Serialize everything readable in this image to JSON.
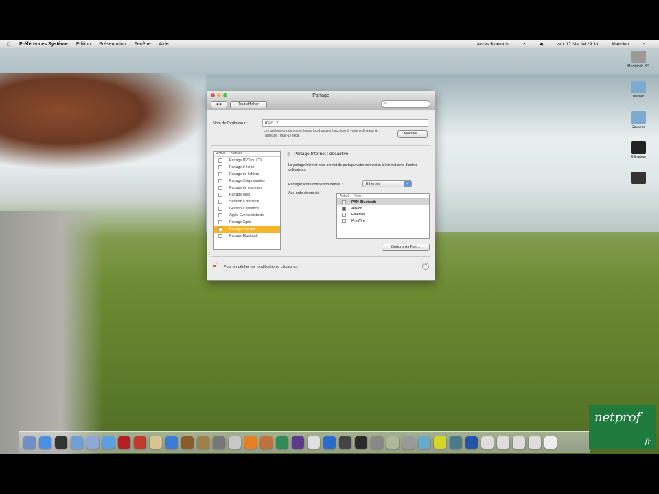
{
  "menubar": {
    "app": "Préférences Système",
    "items": [
      "Édition",
      "Présentation",
      "Fenêtre",
      "Aide"
    ],
    "status": "Accès Bluetooth",
    "clock": "ven. 17 Mai  14:29:33",
    "user": "Matthieu"
  },
  "desktop_icons": [
    {
      "label": "Macintosh HD",
      "color": "#9a9a9a"
    },
    {
      "label": "dossier",
      "color": "#7eaad2"
    },
    {
      "label": "Captures",
      "color": "#7eaad2"
    },
    {
      "label": "Utilisateur",
      "color": "#222222"
    },
    {
      "label": "",
      "color": "#333333"
    }
  ],
  "window": {
    "title": "Partage",
    "show_all": "Tout afficher",
    "search_placeholder": "",
    "computer_name_label": "Nom de l'ordinateur :",
    "computer_name": "mac 17",
    "address_text": "Les ordinateurs de votre réseau local peuvent accéder à votre ordinateur à l'adresse : mac-17.local",
    "edit_button": "Modifier…",
    "services_header": {
      "on": "Activé",
      "service": "Service"
    },
    "services": [
      {
        "label": "Partage DVD ou CD",
        "on": false
      },
      {
        "label": "Partage d'écran",
        "on": false
      },
      {
        "label": "Partage de fichiers",
        "on": false
      },
      {
        "label": "Partage d'imprimantes",
        "on": false
      },
      {
        "label": "Partage de scanners",
        "on": false
      },
      {
        "label": "Partage Web",
        "on": false
      },
      {
        "label": "Session à distance",
        "on": false
      },
      {
        "label": "Gestion à distance",
        "on": false
      },
      {
        "label": "Apple Events distants",
        "on": false
      },
      {
        "label": "Partage Xgrid",
        "on": false
      },
      {
        "label": "Partage Internet",
        "on": false,
        "selected": true
      },
      {
        "label": "Partage Bluetooth",
        "on": false
      }
    ],
    "status": "Partage Internet : désactivé",
    "description": "Le partage Internet vous permet de partager votre connexion à Internet avec d'autres ordinateurs.",
    "share_from_label": "Partager votre connexion depuis :",
    "share_from_value": "Ethernet",
    "to_label": "Aux ordinateurs via :",
    "ports_header": {
      "on": "Activé",
      "port": "Ports"
    },
    "ports": [
      {
        "label": "PAN Bluetooth",
        "on": false,
        "highlight": true
      },
      {
        "label": "AirPort",
        "on": true
      },
      {
        "label": "Ethernet",
        "on": false
      },
      {
        "label": "FireWire",
        "on": false
      }
    ],
    "options_button": "Options AirPort…",
    "lock_text": "Pour empêcher les modifications, cliquez ici.",
    "help": "?"
  },
  "dock": [
    "#6f8fc9",
    "#4a90e2",
    "#333333",
    "#6fa0d8",
    "#8fa8d6",
    "#5aa0e0",
    "#b22222",
    "#c0392b",
    "#d8c490",
    "#3a7bd5",
    "#8b5a2b",
    "#a0804a",
    "#777777",
    "#c8c8c8",
    "#e67e22",
    "#c0703a",
    "#2e8b57",
    "#5b3a8a",
    "#e0e0e0",
    "#2a6bd0",
    "#444444",
    "#2a2a2a",
    "#888888",
    "#b0b89a",
    "#999999",
    "#66aacc",
    "#d6d62a",
    "#4a7a8a",
    "#2255aa",
    "#dddddd",
    "#dddddd",
    "#dddddd",
    "#dddddd",
    "#eeeeee"
  ],
  "watermark": {
    "text": "netprof",
    "suffix": "fr"
  }
}
